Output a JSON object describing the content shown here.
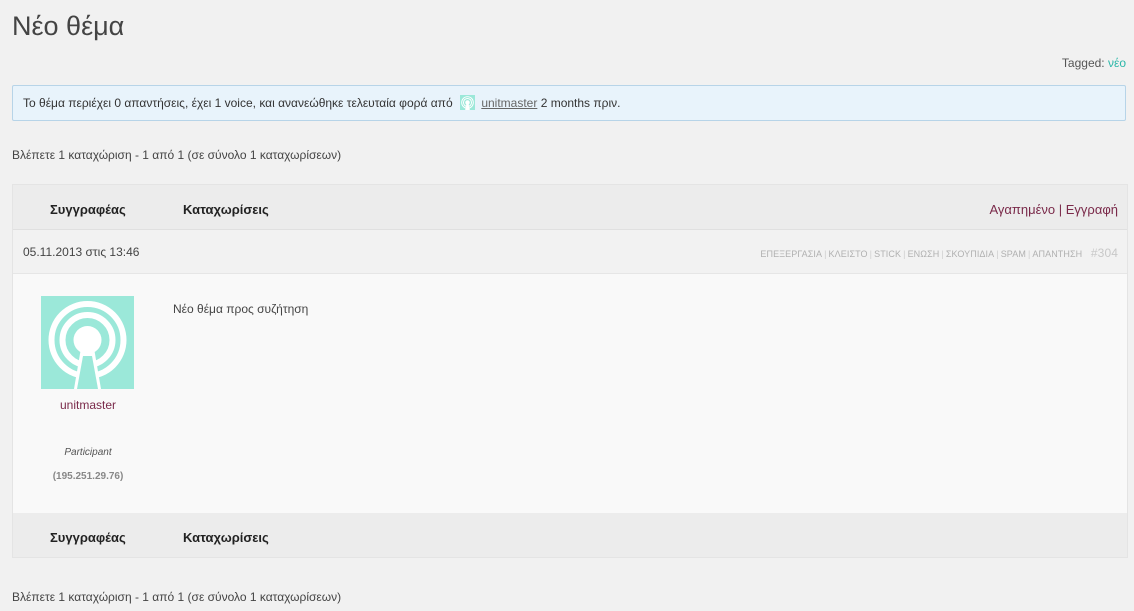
{
  "page": {
    "title": "Νέο θέμα"
  },
  "tags": {
    "label": "Tagged:",
    "items": [
      "νέο"
    ]
  },
  "notice": {
    "text_before": "Το θέμα περιέχει 0 απαντήσεις, έχει 1 voice, και ανανεώθηκε τελευταία φορά από",
    "author": "unitmaster",
    "time_ago": "2 months πριν."
  },
  "pagination": {
    "count_text": "Βλέπετε 1 καταχώριση - 1 από 1 (σε σύνολο 1 καταχωρίσεων)"
  },
  "table": {
    "header": {
      "author_col": "Συγγραφέας",
      "posts_col": "Καταχωρίσεις",
      "favorite": "Αγαπημένο",
      "separator": "|",
      "subscribe": "Εγγραφή"
    },
    "footer": {
      "author_col": "Συγγραφέας",
      "posts_col": "Καταχωρίσεις"
    }
  },
  "post": {
    "date": "05.11.2013 στις 13:46",
    "admin_links": [
      "ΕΠΕΞΕΡΓΑΣΙΑ",
      "ΚΛΕΙΣΤΟ",
      "STICK",
      "ΕΝΩΣΗ",
      "ΣΚΟΥΠΙΔΙΑ",
      "SPAM",
      "ΑΠΑΝΤΗΣΗ"
    ],
    "admin_sep": "|",
    "permalink": "#304",
    "author": {
      "name": "unitmaster",
      "role": "Participant",
      "ip": "(195.251.29.76)",
      "avatar_color": "#9be8d9"
    },
    "content": "Νέο θέμα προς συζήτηση"
  },
  "colors": {
    "accent_teal": "#2bb7a8",
    "link_maroon": "#7a2a4a",
    "notice_bg": "#e8f3fb"
  }
}
